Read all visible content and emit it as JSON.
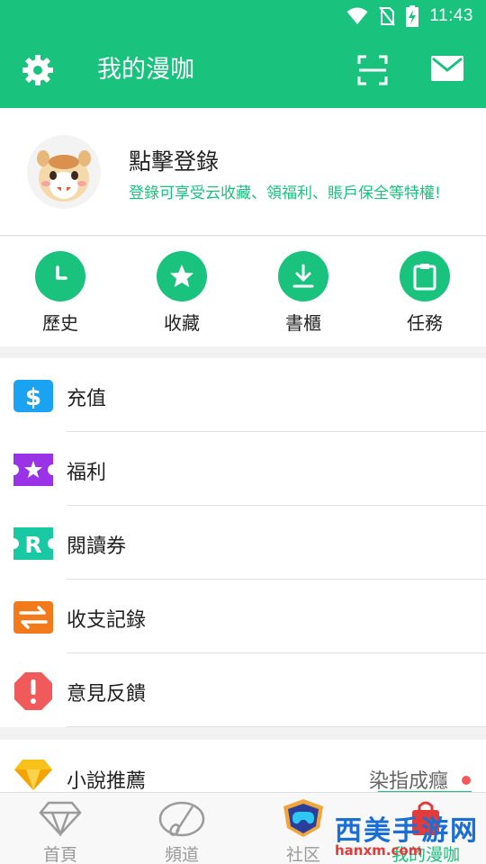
{
  "status_bar": {
    "time": "11:43",
    "icons": [
      "wifi-icon",
      "no-sim-icon",
      "battery-charging-icon"
    ]
  },
  "app_bar": {
    "title": "我的漫咖",
    "icons": [
      "gear-icon",
      "scan-icon",
      "mail-icon"
    ]
  },
  "profile": {
    "login_label": "點擊登錄",
    "subtitle": "登錄可享受云收藏、領福利、賬戶保全等特權!"
  },
  "quick_actions": [
    {
      "label": "歷史",
      "icon": "clock-icon"
    },
    {
      "label": "收藏",
      "icon": "star-icon"
    },
    {
      "label": "書櫃",
      "icon": "download-icon"
    },
    {
      "label": "任務",
      "icon": "clipboard-icon"
    }
  ],
  "menu": [
    {
      "label": "充值",
      "icon": "dollar-icon",
      "color": "#1aa3f0"
    },
    {
      "label": "福利",
      "icon": "ticket-star-icon",
      "color": "#9a33e8"
    },
    {
      "label": "閱讀券",
      "icon": "r-coupon-icon",
      "color": "#19c9a3"
    },
    {
      "label": "收支記錄",
      "icon": "swap-arrows-icon",
      "color": "#f27a1a"
    },
    {
      "label": "意見反饋",
      "icon": "alert-octagon-icon",
      "color": "#f05a5a"
    }
  ],
  "novel_row": {
    "label": "小說推薦",
    "right_text": "染指成癮",
    "icon": "diamond-icon"
  },
  "tab_bar": [
    {
      "label": "首頁",
      "icon": "diamond-outline-icon",
      "active": false
    },
    {
      "label": "頻道",
      "icon": "palette-icon",
      "active": false
    },
    {
      "label": "社区",
      "icon": "gamepad-icon",
      "active": false
    },
    {
      "label": "我的漫咖",
      "icon": "bag-icon",
      "active": true
    }
  ],
  "watermark": {
    "text": "西美手游网",
    "sub": "hanxm.com"
  },
  "colors": {
    "primary": "#19c37d",
    "alert_dot": "#f45a5a"
  }
}
